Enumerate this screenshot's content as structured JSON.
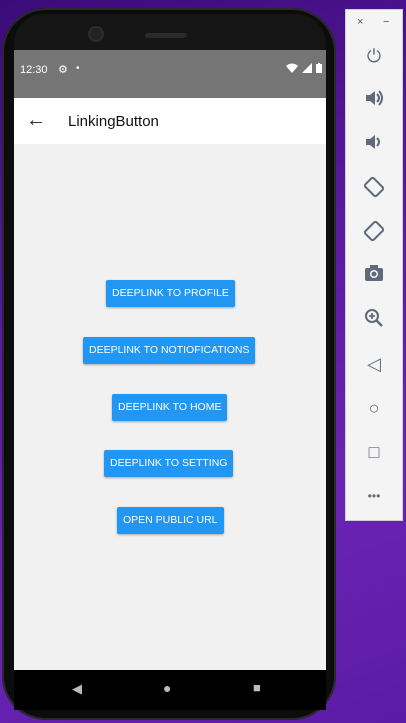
{
  "status_bar": {
    "time": "12:30",
    "gear_icon": "⚙",
    "dot_icon": "•",
    "icons": "▾ ▲ ▮"
  },
  "app_bar": {
    "back_icon": "←",
    "title": "LinkingButton"
  },
  "buttons": [
    {
      "label": "DEEPLINK TO PROFILE"
    },
    {
      "label": "DEEPLINK TO NOTIOFICATIONS"
    },
    {
      "label": "DEEPLINK TO HOME"
    },
    {
      "label": "DEEPLINK TO SETTING"
    },
    {
      "label": "OPEN PUBLIC URL"
    }
  ],
  "nav_bar": {
    "back": "◀",
    "home": "●",
    "recents": "■"
  },
  "emulator_toolbar": {
    "close": "×",
    "minimize": "−",
    "power": "⏻",
    "volume_up": "🔊",
    "volume_down": "🔉",
    "rotate_left": "⟲",
    "rotate_right": "⟳",
    "camera": "📷",
    "zoom": "⊕",
    "back": "◁",
    "home": "○",
    "overview": "□",
    "more": "•••"
  },
  "colors": {
    "accent": "#2196f3",
    "status_bar": "#757575",
    "background": "#f1f1f1"
  }
}
